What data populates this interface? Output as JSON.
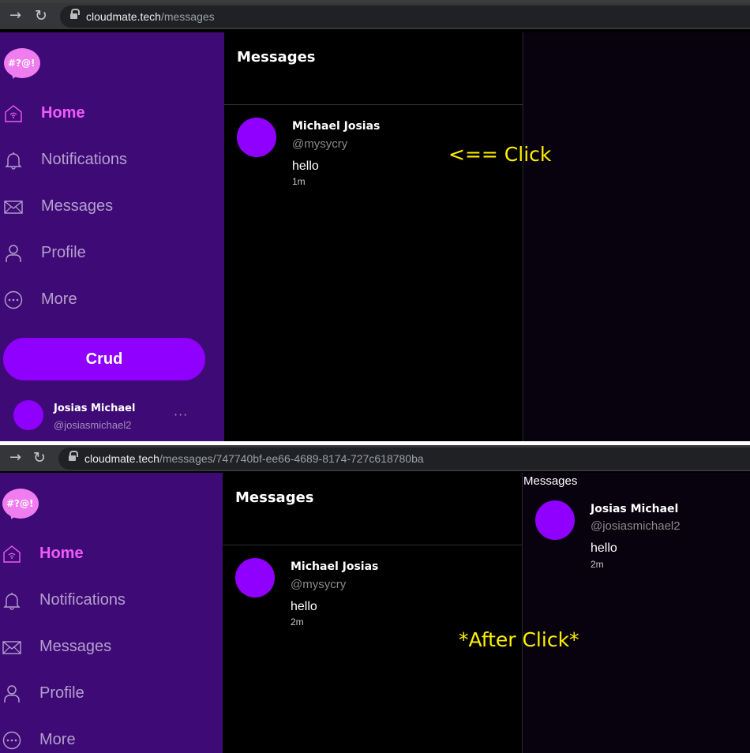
{
  "colors": {
    "sidebar_bg": "#3e0b76",
    "accent_purple": "#9000ff",
    "active_nav": "#ee5bf7",
    "annotation": "#fff000"
  },
  "screens": [
    {
      "browser": {
        "host": "cloudmate.tech",
        "path": "/messages"
      },
      "logo_text": "#?@!",
      "nav": [
        {
          "label": "Home",
          "icon": "home-icon",
          "active": true
        },
        {
          "label": "Notifications",
          "icon": "bell-icon",
          "active": false
        },
        {
          "label": "Messages",
          "icon": "envelope-icon",
          "active": false
        },
        {
          "label": "Profile",
          "icon": "user-icon",
          "active": false
        },
        {
          "label": "More",
          "icon": "more-circle-icon",
          "active": false
        }
      ],
      "crud_label": "Crud",
      "current_user": {
        "name": "Josias Michael",
        "handle": "@josiasmichael2",
        "menu": "···"
      },
      "middle_title": "Messages",
      "conversation": {
        "name": "Michael Josias",
        "handle": "@mysycry",
        "message": "hello",
        "time": "1m"
      },
      "annotation": "<== Click"
    },
    {
      "browser": {
        "host": "cloudmate.tech",
        "path": "/messages/747740bf-ee66-4689-8174-727c618780ba"
      },
      "logo_text": "#?@!",
      "nav": [
        {
          "label": "Home",
          "icon": "home-icon",
          "active": true
        },
        {
          "label": "Notifications",
          "icon": "bell-icon",
          "active": false
        },
        {
          "label": "Messages",
          "icon": "envelope-icon",
          "active": false
        },
        {
          "label": "Profile",
          "icon": "user-icon",
          "active": false
        },
        {
          "label": "More",
          "icon": "more-circle-icon",
          "active": false
        }
      ],
      "middle_title": "Messages",
      "conversation": {
        "name": "Michael Josias",
        "handle": "@mysycry",
        "message": "hello",
        "time": "2m"
      },
      "right_panel": {
        "title": "Messages",
        "message": {
          "name": "Josias Michael",
          "handle": "@josiasmichael2",
          "text": "hello",
          "time": "2m"
        }
      },
      "annotation": "*After Click*"
    }
  ]
}
